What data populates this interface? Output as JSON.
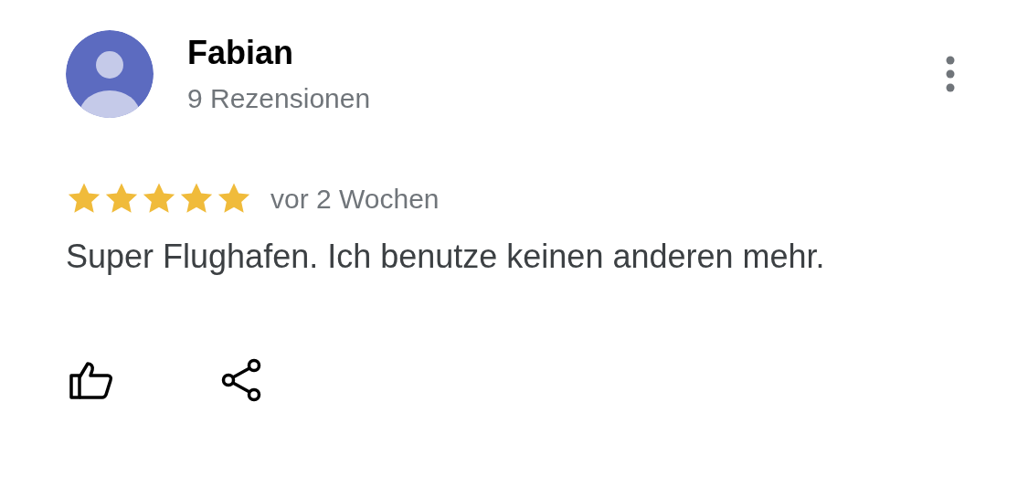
{
  "review": {
    "author": "Fabian",
    "review_count": "9 Rezensionen",
    "stars": 5,
    "time": "vor 2 Wochen",
    "text": "Super Flughafen. Ich benutze keinen anderen mehr."
  }
}
